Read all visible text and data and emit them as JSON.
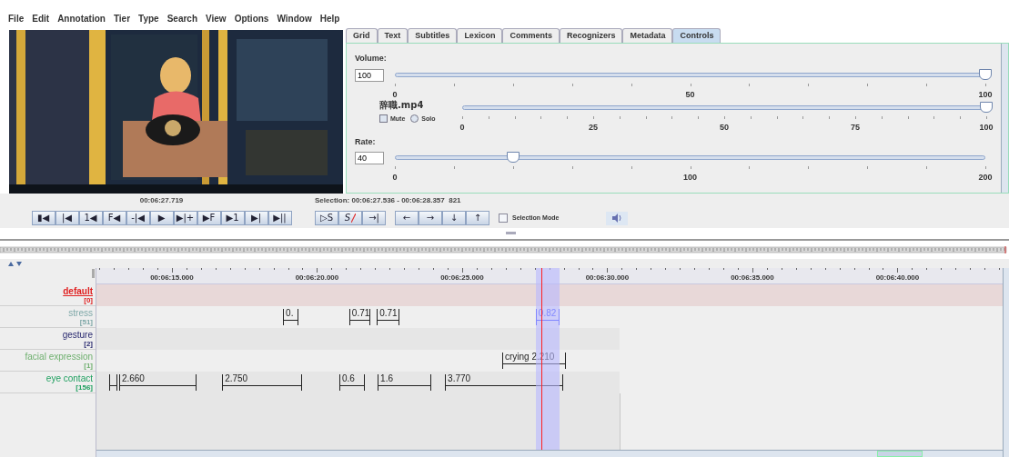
{
  "menu": [
    "File",
    "Edit",
    "Annotation",
    "Tier",
    "Type",
    "Search",
    "View",
    "Options",
    "Window",
    "Help"
  ],
  "video": {
    "kind": "picture"
  },
  "tabs": [
    {
      "label": "Grid",
      "selected": false
    },
    {
      "label": "Text",
      "selected": false
    },
    {
      "label": "Subtitles",
      "selected": false
    },
    {
      "label": "Lexicon",
      "selected": false
    },
    {
      "label": "Comments",
      "selected": false
    },
    {
      "label": "Recognizers",
      "selected": false
    },
    {
      "label": "Metadata",
      "selected": false
    },
    {
      "label": "Controls",
      "selected": true
    }
  ],
  "controls": {
    "volume": {
      "label": "Volume:",
      "value": "100",
      "level": 1,
      "ticks": [
        "0",
        "50",
        "100"
      ]
    },
    "media": {
      "file": "辞職.mp4",
      "level": 1,
      "ticks": [
        "0",
        "25",
        "50",
        "75",
        "100"
      ],
      "mute": {
        "label": "Mute",
        "checked": false
      },
      "solo": {
        "label": "Solo",
        "selected": false
      }
    },
    "rate": {
      "label": "Rate:",
      "value": "40",
      "level": 0.2,
      "ticks": [
        "0",
        "100",
        "200"
      ]
    }
  },
  "player": {
    "time": "00:06:27.719",
    "selection": "Selection: 00:06:27.536 - 00:06:28.357  821",
    "transport": [
      "▮◀",
      "|◀",
      "1◀",
      "F◀",
      "-|◀",
      "▶",
      "▶|+",
      "▶F",
      "▶1",
      "▶|",
      "▶||"
    ],
    "selection_buttons": [
      "▷S",
      "S",
      "→|"
    ],
    "arrows": [
      "←",
      "→",
      "↓",
      "↑"
    ],
    "selection_mode": {
      "label": "Selection Mode",
      "checked": false
    }
  },
  "timeline": {
    "ruler": [
      "00:06:15.000",
      "00:06:20.000",
      "00:06:25.000",
      "00:06:30.000",
      "00:06:35.000",
      "00:06:40.000"
    ],
    "tiers": [
      {
        "name": "default",
        "count": "[0]",
        "color": "#e02020",
        "selected": true
      },
      {
        "name": "stress",
        "count": "[51]",
        "color": "#7fa8a8",
        "selected": false,
        "annotations": [
          {
            "text": "0.",
            "selected": false
          },
          {
            "text": "0.71",
            "selected": false
          },
          {
            "text": "0.71",
            "selected": false
          },
          {
            "text": "0.82",
            "selected": true
          }
        ]
      },
      {
        "name": "gesture",
        "count": "[2]",
        "color": "#2a2a70",
        "selected": false
      },
      {
        "name": "facial expression",
        "count": "[1]",
        "color": "#6fb06f",
        "selected": false,
        "annotations": [
          {
            "text": "crying 2.210",
            "selected": false
          }
        ]
      },
      {
        "name": "eye contact",
        "count": "[156]",
        "color": "#20a060",
        "selected": false,
        "annotations": [
          {
            "selected": false
          },
          {
            "text": "2.660",
            "selected": false
          },
          {
            "text": "2.750",
            "selected": false
          },
          {
            "text": "0.6",
            "selected": false
          },
          {
            "text": "1.6",
            "selected": false
          },
          {
            "text": "3.770",
            "selected": false
          }
        ]
      }
    ]
  }
}
